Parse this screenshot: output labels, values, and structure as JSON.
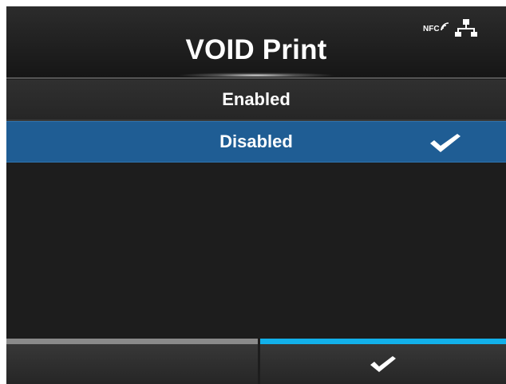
{
  "header": {
    "title": "VOID Print",
    "status_icons": {
      "nfc_label": "NFC",
      "nfc_icon": "nfc-wireless-icon",
      "network_icon": "network-icon"
    }
  },
  "menu": {
    "items": [
      {
        "label": "Enabled",
        "selected": false
      },
      {
        "label": "Disabled",
        "selected": true,
        "icon": "checkmark-icon"
      }
    ]
  },
  "footer": {
    "left_button": {
      "label": ""
    },
    "right_button": {
      "icon": "checkmark-icon"
    }
  },
  "colors": {
    "background": "#1d1d1d",
    "selection": "#1f5d94",
    "accent": "#12b0ea",
    "back_bar": "#8a8a8a",
    "text": "#ffffff"
  }
}
